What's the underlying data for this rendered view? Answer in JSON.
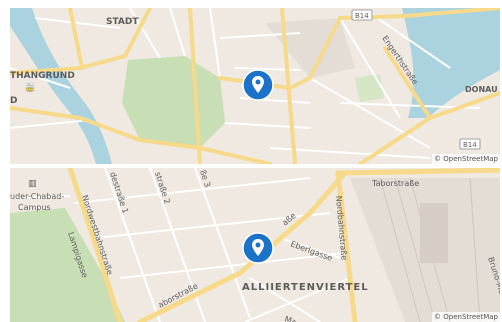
{
  "map_top": {
    "labels": {
      "stadt": "STADT",
      "hangrund": "THANGRUND",
      "d": "D",
      "route_b14_top": "B14",
      "route_b14_bottom": "B14",
      "engerthstrasse": "Engerthstraße",
      "donau": "DONAU"
    },
    "attribution": "© OpenStreetMap",
    "colors": {
      "land": "#efe9e1",
      "park": "#c8dfb6",
      "water": "#aad3df",
      "major_road": "#f7d98a",
      "pin": "#1a73c8"
    }
  },
  "map_bottom": {
    "labels": {
      "campus_1": "uder-Chabad-",
      "campus_2": "Campus",
      "nordwestbahnstr": "Nordwestbahnstraße",
      "lampigasse": "Lampigasse",
      "strasse_1": "destraße 1",
      "strasse_2": "straße 2",
      "strasse_3": "ße 3",
      "taborstrasse_left": "aborstraße",
      "strasse_center": "aße",
      "eberlgasse": "Eberlgasse",
      "nordbahnstrasse": "Nordbahnstraße",
      "taborstrasse_right": "Taborstraße",
      "bruno_marek": "Bruno-Marek-",
      "alliiertenviertel": "ALLIIERTENVIERTEL",
      "ma": "Ma"
    },
    "attribution": "© OpenStreetMap",
    "colors": {
      "land": "#efe9e1",
      "park": "#c8dfb6",
      "railway": "#d9d0c9",
      "major_road": "#f7d98a",
      "pin": "#1a73c8"
    }
  }
}
